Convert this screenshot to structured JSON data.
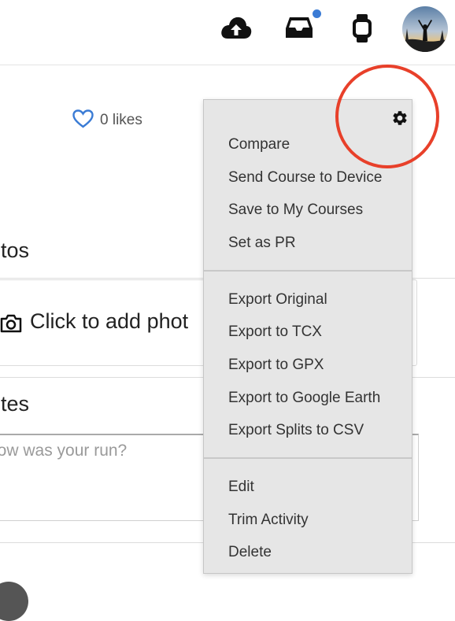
{
  "header": {
    "icons": [
      "cloud-upload-icon",
      "inbox-icon",
      "watch-icon"
    ],
    "notification_color": "#3a7bd5"
  },
  "activity": {
    "likes": "0 likes",
    "photos_title": "otos",
    "add_photo": "Click to add phot",
    "notes_title": "otes",
    "notes_placeholder": "low was your run?"
  },
  "menu": {
    "gear_icon": "gear-icon",
    "group1": [
      "Compare",
      "Send Course to Device",
      "Save to My Courses",
      "Set as PR"
    ],
    "group2": [
      "Export Original",
      "Export to TCX",
      "Export to GPX",
      "Export to Google Earth",
      "Export Splits to CSV"
    ],
    "group3": [
      "Edit",
      "Trim Activity",
      "Delete"
    ]
  },
  "colors": {
    "annotation_circle": "#e8402a",
    "like_heart": "#3a7bd5",
    "menu_bg": "#e6e6e6"
  }
}
